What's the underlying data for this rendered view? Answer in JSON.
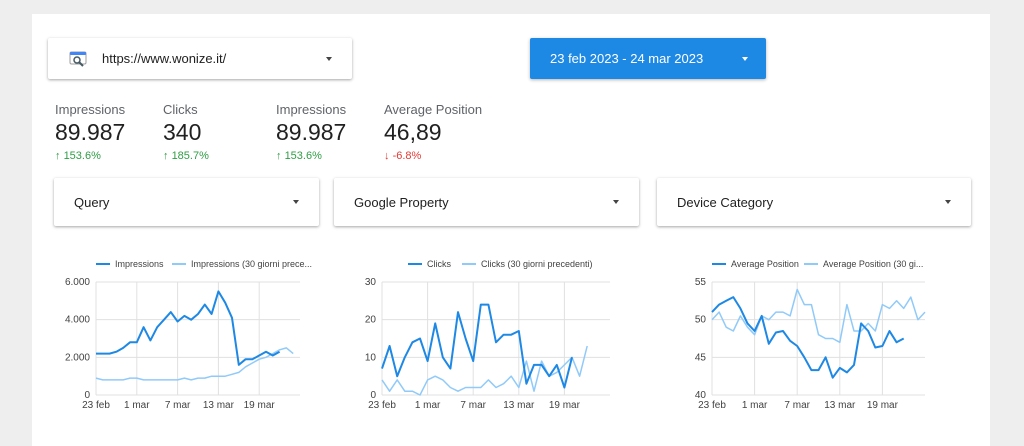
{
  "site_selector": {
    "url": "https://www.wonize.it/",
    "icon": "search-console-icon"
  },
  "date_selector": {
    "label": "23 feb 2023 - 24 mar 2023"
  },
  "kpis": [
    {
      "label": "Impressions",
      "value": "89.987",
      "delta": "153.6%",
      "direction": "up"
    },
    {
      "label": "Clicks",
      "value": "340",
      "delta": "185.7%",
      "direction": "up"
    },
    {
      "label": "Impressions",
      "value": "89.987",
      "delta": "153.6%",
      "direction": "up"
    },
    {
      "label": "Average Position",
      "value": "46,89",
      "delta": "-6.8%",
      "direction": "down"
    }
  ],
  "filters": [
    {
      "label": "Query"
    },
    {
      "label": "Google Property"
    },
    {
      "label": "Device Category"
    }
  ],
  "colors": {
    "primary": "#1e88e5",
    "previous": "#90caf9",
    "up": "#2e9e44",
    "down": "#e53935"
  },
  "chart_data": [
    {
      "type": "line",
      "x_ticks": [
        "23 feb",
        "1 mar",
        "7 mar",
        "13 mar",
        "19 mar"
      ],
      "y_ticks": [
        "0",
        "2.000",
        "4.000",
        "6.000"
      ],
      "ylim": [
        0,
        6000
      ],
      "grid": true,
      "legend_position": "top",
      "series": [
        {
          "name": "Impressions",
          "values": [
            2200,
            2200,
            2200,
            2300,
            2500,
            2800,
            2800,
            3600,
            2900,
            3600,
            4000,
            4400,
            3900,
            4200,
            4000,
            4300,
            4800,
            4300,
            5500,
            4900,
            4100,
            1600,
            1900,
            1900,
            2100,
            2300,
            2100,
            2300
          ]
        },
        {
          "name": "Impressions (30 giorni prece...",
          "values": [
            900,
            800,
            800,
            800,
            800,
            900,
            900,
            800,
            800,
            800,
            800,
            800,
            800,
            900,
            800,
            900,
            900,
            1000,
            1000,
            1000,
            1100,
            1200,
            1500,
            1700,
            1900,
            2000,
            2200,
            2400,
            2500,
            2200
          ]
        }
      ]
    },
    {
      "type": "line",
      "x_ticks": [
        "23 feb",
        "1 mar",
        "7 mar",
        "13 mar",
        "19 mar"
      ],
      "y_ticks": [
        "0",
        "10",
        "20",
        "30"
      ],
      "ylim": [
        0,
        30
      ],
      "grid": true,
      "legend_position": "top",
      "series": [
        {
          "name": "Clicks",
          "values": [
            7,
            13,
            5,
            10,
            14,
            15,
            9,
            19,
            10,
            7,
            22,
            15,
            9,
            24,
            24,
            14,
            16,
            16,
            17,
            3,
            8,
            8,
            5,
            8,
            2,
            10
          ]
        },
        {
          "name": "Clicks (30 giorni precedenti)",
          "values": [
            4,
            1,
            4,
            1,
            1,
            0,
            4,
            5,
            4,
            2,
            1,
            2,
            2,
            2,
            4,
            2,
            3,
            5,
            2,
            9,
            1,
            9,
            5,
            6,
            8,
            10,
            5,
            13
          ]
        }
      ]
    },
    {
      "type": "line",
      "x_ticks": [
        "23 feb",
        "1 mar",
        "7 mar",
        "13 mar",
        "19 mar"
      ],
      "y_ticks": [
        "40",
        "45",
        "50",
        "55"
      ],
      "ylim": [
        40,
        55
      ],
      "grid": true,
      "legend_position": "top",
      "series": [
        {
          "name": "Average Position",
          "values": [
            51,
            52,
            52.5,
            53,
            51.5,
            49.5,
            48.5,
            50.5,
            46.8,
            48.3,
            48.5,
            47.2,
            46.5,
            45,
            43.3,
            43.3,
            45,
            42.3,
            43.6,
            43,
            44,
            49.5,
            48.5,
            46.3,
            46.5,
            48.5,
            47,
            47.5
          ]
        },
        {
          "name": "Average Position (30 gi...",
          "values": [
            50,
            51,
            49,
            48.5,
            50.5,
            49,
            48,
            50.5,
            50,
            51,
            51,
            50.5,
            54,
            52,
            52,
            48,
            47.5,
            47.5,
            47,
            52,
            48.5,
            48.5,
            49.5,
            48.5,
            52,
            51.5,
            52.5,
            51.5,
            53,
            50,
            51
          ]
        }
      ]
    }
  ]
}
